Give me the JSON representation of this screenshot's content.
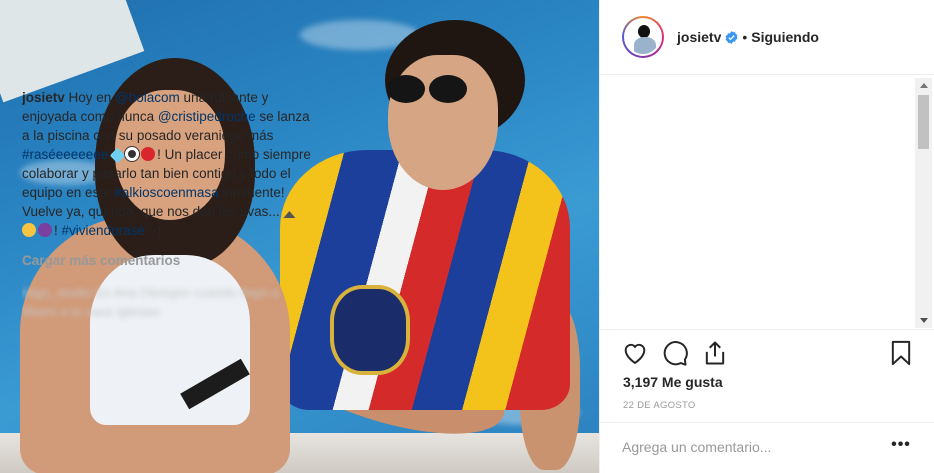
{
  "header": {
    "username": "josietv",
    "separator": "•",
    "follow_label": "Siguiendo"
  },
  "caption": {
    "user": "josietv",
    "t1": " Hoy en ",
    "mention1": "@holacom",
    "t2": " una rutilante y enjoyada como nunca ",
    "mention2": "@cristipedroche",
    "t3": " se lanza a la piscina con su posado veraniego más ",
    "hashtag1": "#raséeeeeeee",
    "t4": "! Un placer cómo siempre colaborar y pasarlo tan bien contigo y todo el equipo en este ",
    "hashtag2": "#alkioscoenmasa",
    "t5": " inminente! Vuelve ya, querida, que nos dan las uvas... ",
    "t6": "!",
    "hashtag3": "#viviendorasé",
    "t7": " :-)"
  },
  "load_more": "Cargar más comentarios",
  "blurred_comment": "lolgo_studio Es Ana Obregón cuando llegó a Miami a la casa Iglesias",
  "likes": "3,197 Me gusta",
  "date": "22 DE AGOSTO",
  "comment_placeholder": "Agrega un comentario...",
  "more_label": "•••",
  "icons": {
    "verified": "verified-badge-icon",
    "like": "heart-icon",
    "comment": "comment-bubble-icon",
    "share": "share-icon",
    "save": "bookmark-icon"
  },
  "colors": {
    "link": "#003569",
    "muted": "#999999",
    "verified": "#3897f0"
  }
}
